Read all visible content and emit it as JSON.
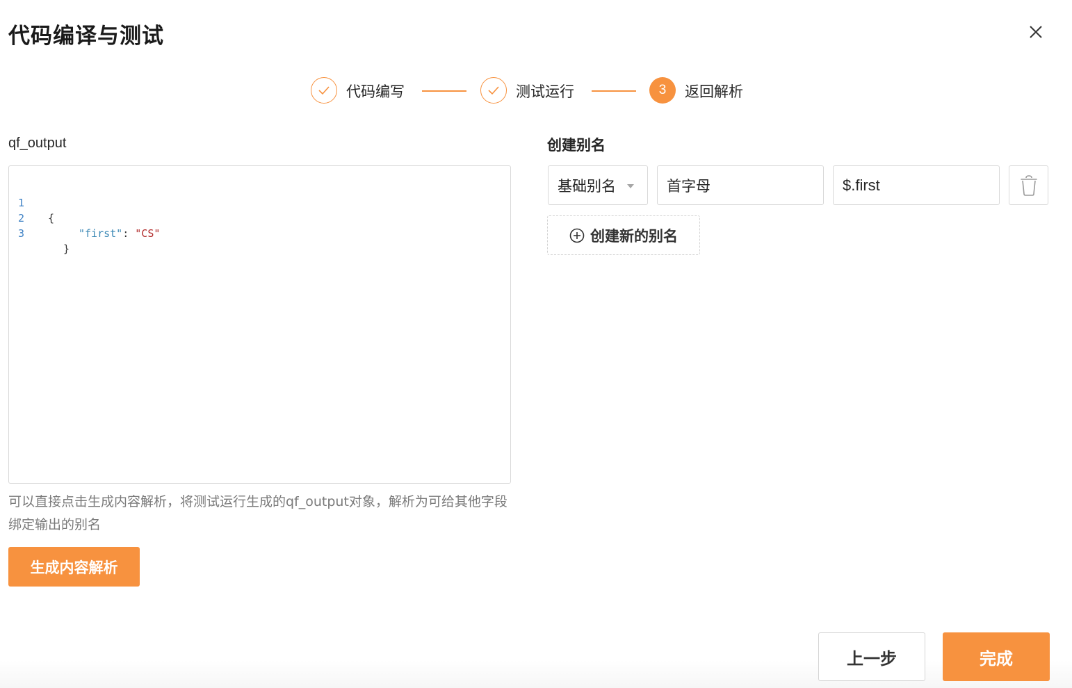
{
  "dialog": {
    "title": "代码编译与测试"
  },
  "steps": [
    {
      "label": "代码编写",
      "status": "done"
    },
    {
      "label": "测试运行",
      "status": "done"
    },
    {
      "label": "返回解析",
      "status": "active",
      "number": "3"
    }
  ],
  "left": {
    "label": "qf_output",
    "code": {
      "line_numbers": [
        "1",
        "2",
        "3"
      ],
      "lines": [
        "{",
        "\"first\": \"CS\"",
        "}"
      ],
      "key": "\"first\"",
      "colon": ": ",
      "value": "\"CS\""
    },
    "help_text": "可以直接点击生成内容解析，将测试运行生成的qf_output对象，解析为可给其他字段绑定输出的别名",
    "generate_button": "生成内容解析"
  },
  "right": {
    "label": "创建别名",
    "alias_row": {
      "type_value": "基础别名",
      "name_value": "首字母",
      "path_value": "$.first"
    },
    "add_button": "创建新的别名"
  },
  "footer": {
    "prev_button": "上一步",
    "done_button": "完成"
  },
  "colors": {
    "accent": "#f7923f",
    "border": "#d9d9d9",
    "help_text": "#7a7a7a"
  },
  "icons": [
    "close-icon",
    "check-icon",
    "chevron-down-icon",
    "trash-icon",
    "plus-circle-icon"
  ]
}
